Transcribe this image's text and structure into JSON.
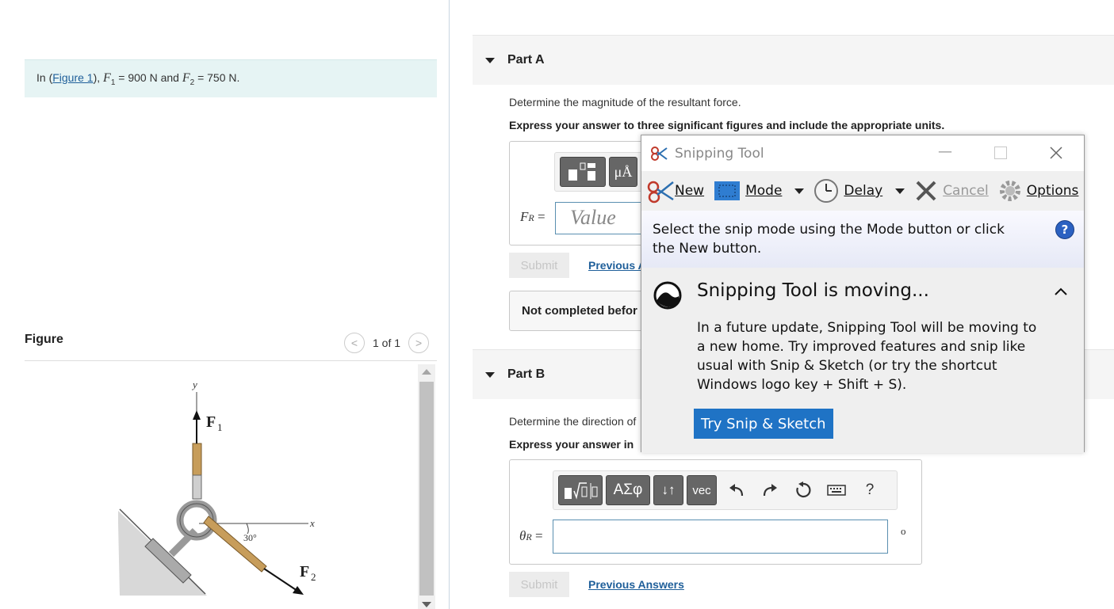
{
  "problem": {
    "prefix": "In (",
    "figure_link": "Figure 1",
    "suffix": "),",
    "f1_label": "F",
    "f1_sub": "1",
    "f1_value": " = 900 N and ",
    "f2_label": "F",
    "f2_sub": "2",
    "f2_value": " = 750 N."
  },
  "figure": {
    "heading": "Figure",
    "pager": "1 of 1",
    "prev_glyph": "<",
    "next_glyph": ">",
    "label_y": "y",
    "label_x": "x",
    "label_f1": "F",
    "label_f1_sub": "1",
    "label_f2": "F",
    "label_f2_sub": "2",
    "label_angle": "30°"
  },
  "partA": {
    "title": "Part A",
    "question": "Determine the magnitude of the resultant force.",
    "instruction": "Express your answer to three significant figures and include the appropriate units.",
    "unit_button": "μÅ",
    "field_label": "F",
    "field_label_sub": "R",
    "field_label_eq": " =",
    "value_placeholder": "Value",
    "submit": "Submit",
    "previous": "Previous A",
    "status": "Not completed befor"
  },
  "partB": {
    "title": "Part B",
    "question": "Determine the direction of",
    "instruction": "Express your answer in",
    "greek_button": "ΑΣφ",
    "sort_button": "↓↑",
    "vec_button": "vec",
    "help_button": "?",
    "field_label": "θ",
    "field_label_sub": "R",
    "field_label_eq": " =",
    "unit": "o",
    "submit": "Submit",
    "previous": "Previous Answers"
  },
  "snipping_tool": {
    "title": "Snipping Tool",
    "new": "New",
    "mode": "Mode",
    "delay": "Delay",
    "cancel": "Cancel",
    "options": "Options",
    "message": "Select the snip mode using the Mode button or click the New button.",
    "help": "?",
    "banner_title": "Snipping Tool is moving...",
    "banner_body": "In a future update, Snipping Tool will be moving to a new home. Try improved features and snip like usual with Snip & Sketch (or try the shortcut Windows logo key + Shift + S).",
    "try_button": "Try Snip & Sketch"
  }
}
